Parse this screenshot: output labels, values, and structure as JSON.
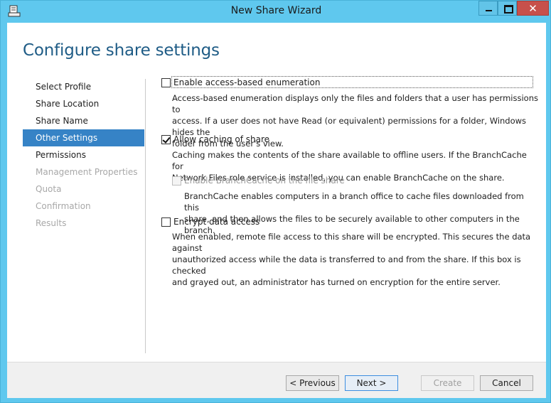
{
  "window": {
    "title": "New Share Wizard"
  },
  "page": {
    "title": "Configure share settings"
  },
  "nav": {
    "items": [
      {
        "label": "Select Profile",
        "state": "normal"
      },
      {
        "label": "Share Location",
        "state": "normal"
      },
      {
        "label": "Share Name",
        "state": "normal"
      },
      {
        "label": "Other Settings",
        "state": "selected"
      },
      {
        "label": "Permissions",
        "state": "normal"
      },
      {
        "label": "Management Properties",
        "state": "disabled"
      },
      {
        "label": "Quota",
        "state": "disabled"
      },
      {
        "label": "Confirmation",
        "state": "disabled"
      },
      {
        "label": "Results",
        "state": "disabled"
      }
    ]
  },
  "options": {
    "abe": {
      "label": "Enable access-based enumeration",
      "checked": false,
      "desc_lines": [
        "Access-based enumeration displays only the files and folders that a user has permissions to",
        "access. If a user does not have Read (or equivalent) permissions for a folder, Windows hides the",
        "folder from the user's view."
      ]
    },
    "caching": {
      "label": "Allow caching of share",
      "checked": true,
      "desc_lines": [
        "Caching makes the contents of the share available to offline users. If the BranchCache for",
        "Network Files role service is installed, you can enable BranchCache on the share."
      ]
    },
    "branchcache": {
      "label": "Enable BranchCache on the file share",
      "checked": false,
      "disabled": true,
      "desc_lines": [
        "BranchCache enables computers in a branch office to cache files downloaded from this",
        "share, and then allows the files to be securely available to other computers in the branch."
      ]
    },
    "encrypt": {
      "label": "Encrypt data access",
      "checked": false,
      "desc_lines": [
        "When enabled, remote file access to this share will be encrypted. This secures the data against",
        "unauthorized access while the data is transferred to and from the share. If this box is checked",
        "and grayed out, an administrator has turned on encryption for the entire server."
      ]
    }
  },
  "buttons": {
    "previous": "< Previous",
    "next": "Next >",
    "create": "Create",
    "cancel": "Cancel"
  },
  "colors": {
    "titlebar": "#5fc8ee",
    "close": "#c7504b",
    "heading": "#1f5c86",
    "nav_selected": "#3683c6"
  }
}
